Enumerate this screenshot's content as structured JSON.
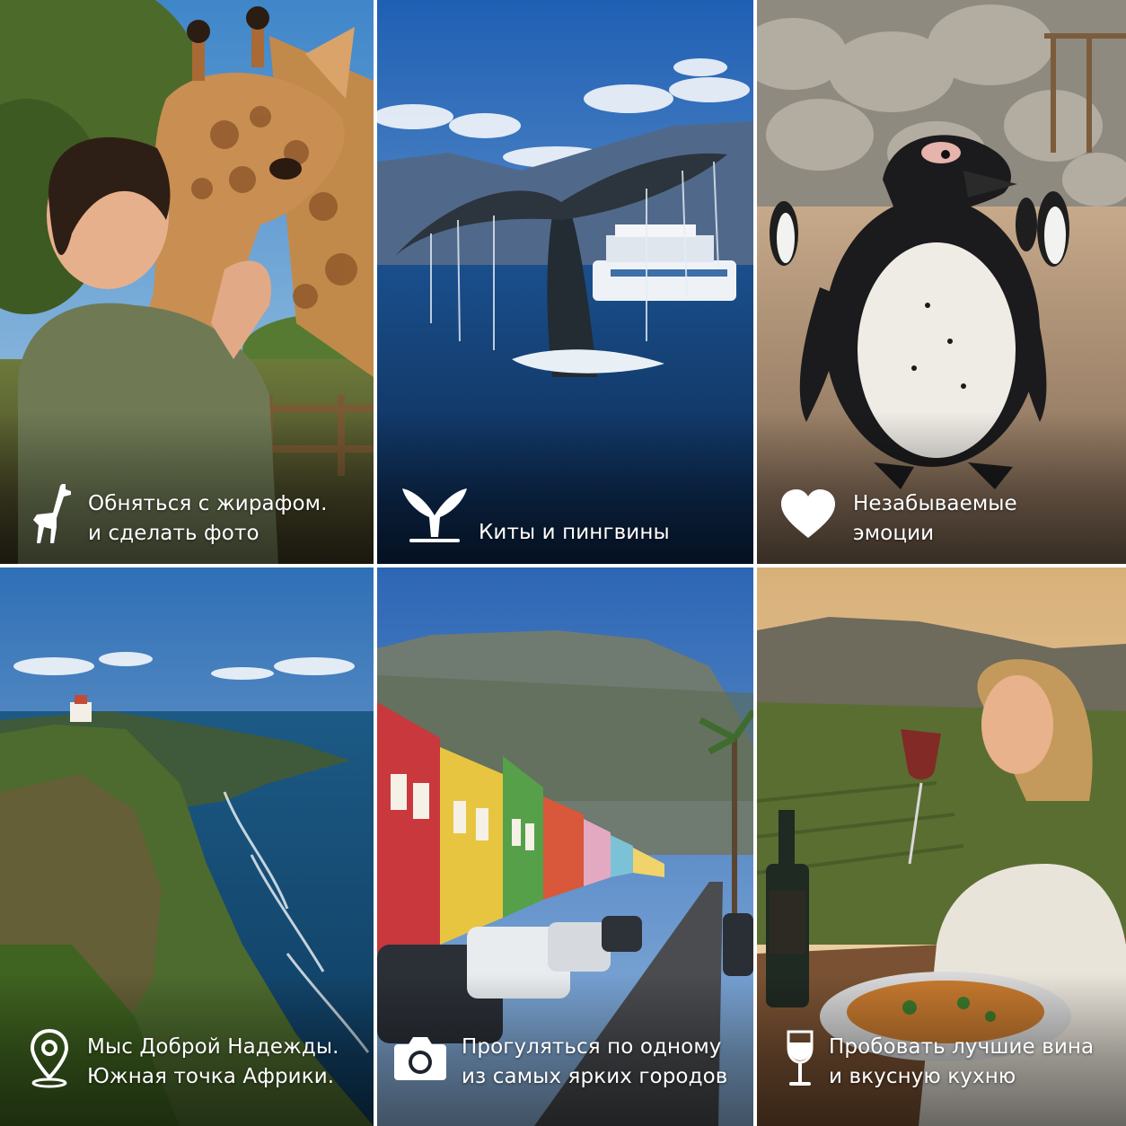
{
  "colors": {
    "divider": "#ffffff",
    "caption_text": "#ffffff"
  },
  "tiles": [
    {
      "icon": "giraffe-icon",
      "line1": "Обняться с жирафом.",
      "line2": "и сделать фото"
    },
    {
      "icon": "whale-tail-icon",
      "line1": "Киты и пингвины",
      "line2": ""
    },
    {
      "icon": "heart-icon",
      "line1": "Незабываемые",
      "line2": "эмоции"
    },
    {
      "icon": "location-pin-icon",
      "line1": "Мыс Доброй Надежды.",
      "line2": "Южная точка Африки."
    },
    {
      "icon": "camera-icon",
      "line1": "Прогуляться по одному",
      "line2": "из самых ярких городов"
    },
    {
      "icon": "wine-glass-icon",
      "line1": "Пробовать лучшие вина",
      "line2": "и вкусную кухню"
    }
  ]
}
